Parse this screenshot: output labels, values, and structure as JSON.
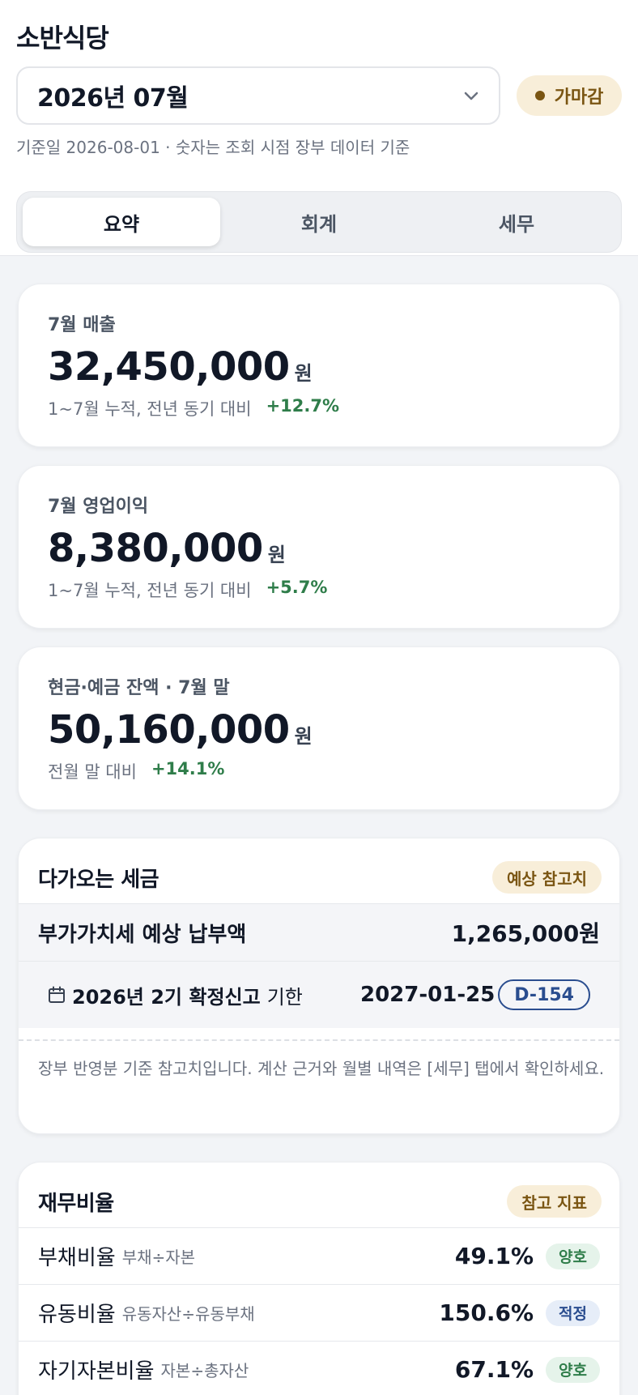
{
  "header": {
    "title": "소반식당",
    "month_value": "2026년 07월",
    "status": "가마감",
    "basis": "기준일 2026-08-01 · 숫자는 조회 시점 장부 데이터 기준"
  },
  "tabs": [
    {
      "label": "요약"
    },
    {
      "label": "회계"
    },
    {
      "label": "세무"
    }
  ],
  "metrics": [
    {
      "label": "7월 매출",
      "amount": "32,450,000",
      "unit": "원",
      "compare": "1~7월 누적, 전년 동기 대비",
      "delta": "+12.7%"
    },
    {
      "label": "7월 영업이익",
      "amount": "8,380,000",
      "unit": "원",
      "compare": "1~7월 누적, 전년 동기 대비",
      "delta": "+5.7%"
    },
    {
      "label": "현금·예금 잔액 · 7월 말",
      "amount": "50,160,000",
      "unit": "원",
      "compare": "전월 말 대비",
      "delta": "+14.1%"
    }
  ],
  "tax": {
    "title": "다가오는 세금",
    "chip": "예상 참고치",
    "vat_label": "부가가치세 예상 납부액",
    "vat_amount": "1,265,000원",
    "period": "2026년 2기 확정신고",
    "deadline_word": "기한",
    "due_date": "2027-01-25",
    "dday": "D-154",
    "note": "장부 반영분 기준 참고치입니다. 계산 근거와 월별 내역은 [세무] 탭에서 확인하세요."
  },
  "ratios": {
    "title": "재무비율",
    "chip": "참고 지표",
    "rows": [
      {
        "name": "부채비율",
        "formula": "부채÷자본",
        "value": "49.1%",
        "tag": "양호"
      },
      {
        "name": "유동비율",
        "formula": "유동자산÷유동부채",
        "value": "150.6%",
        "tag": "적정"
      },
      {
        "name": "자기자본비율",
        "formula": "자본÷총자산",
        "value": "67.1%",
        "tag": "양호"
      }
    ]
  },
  "colors": {
    "accent_good": "#2f7d4a",
    "accent_info": "#2a4d8f",
    "warning_bg": "#f8eed9",
    "warning_fg": "#7a5512"
  },
  "icons": {
    "month_select": "chevron-down-icon",
    "due": "calendar-icon"
  }
}
